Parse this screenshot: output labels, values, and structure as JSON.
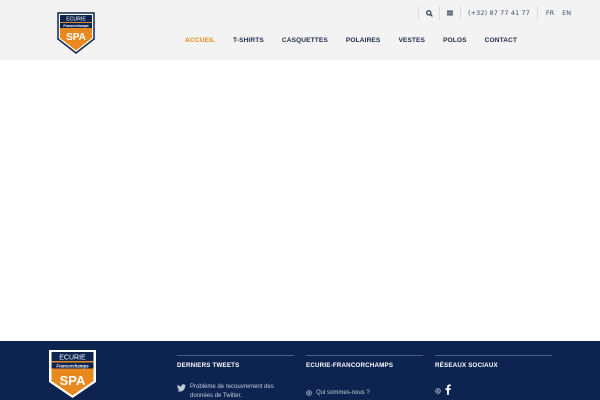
{
  "header": {
    "logo": {
      "line1": "ECURIE",
      "line2": "Francorchamps",
      "line3": "SPA"
    },
    "topbar": {
      "search_icon": "search-icon",
      "menu_icon": "menu-icon",
      "phone": "(+32) 87 77 41 77",
      "languages": [
        "FR",
        "EN"
      ]
    },
    "nav": [
      "ACCUEIL",
      "T-SHIRTS",
      "CASQUETTES",
      "POLAIRES",
      "VESTES",
      "POLOS",
      "CONTACT"
    ],
    "active_nav": "ACCUEIL"
  },
  "footer": {
    "logo": {
      "line1": "ECURIE",
      "line2": "Francorchamps",
      "line3": "SPA"
    },
    "tweets": {
      "title": "DERNIERS TWEETS",
      "text": "Problème de recouvrement des données de Twitter."
    },
    "ecurie": {
      "title": "ECURIE-FRANCORCHAMPS",
      "link": "Qui sommes-nous ?"
    },
    "social": {
      "title": "RÉSEAUX SOCIAUX",
      "icons": [
        "circle-icon",
        "facebook-icon"
      ]
    }
  },
  "colors": {
    "header_bg": "#f3f3f3",
    "footer_bg": "#0e2450",
    "accent": "#e8891f",
    "nav_text": "#1d2a4d"
  }
}
